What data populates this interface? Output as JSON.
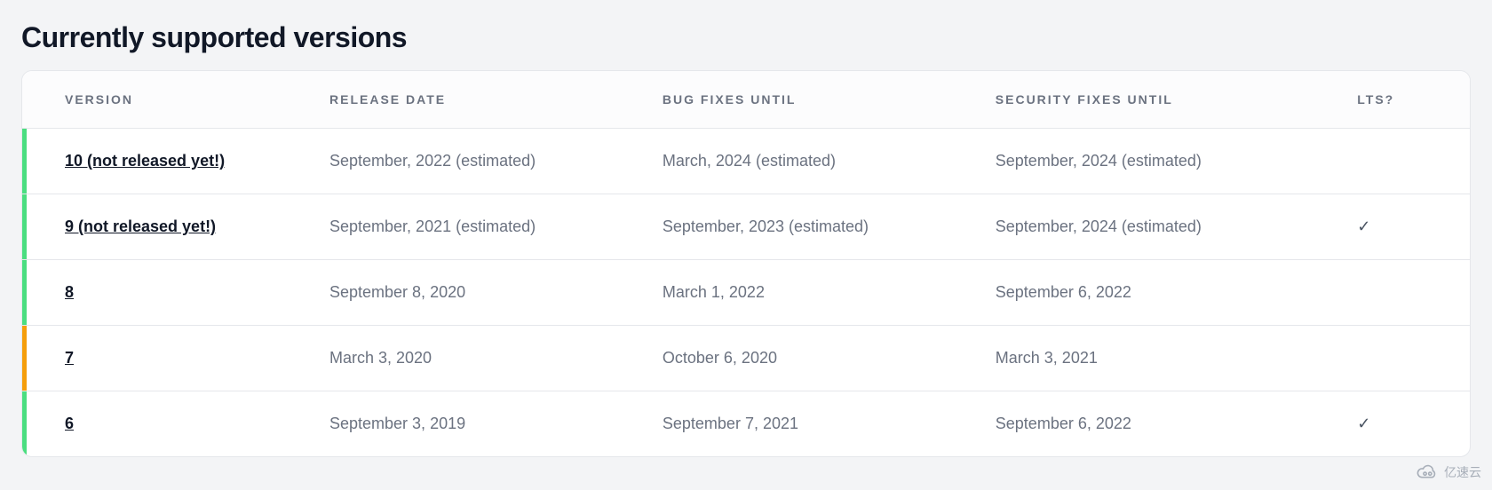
{
  "title": "Currently supported versions",
  "columns": {
    "version": "Version",
    "release_date": "Release Date",
    "bug_fixes_until": "Bug Fixes Until",
    "security_fixes_until": "Security Fixes Until",
    "lts": "LTS?"
  },
  "status_colors": {
    "future": "#4ade80",
    "active": "#4ade80",
    "security": "#f59e0b",
    "lts_active": "#4ade80"
  },
  "lts_check_glyph": "✓",
  "rows": [
    {
      "version": "10 (not released yet!)",
      "release_date": "September, 2022 (estimated)",
      "bug_fixes_until": "March, 2024 (estimated)",
      "security_fixes_until": "September, 2024 (estimated)",
      "lts": false,
      "stripe": "green"
    },
    {
      "version": "9 (not released yet!)",
      "release_date": "September, 2021 (estimated)",
      "bug_fixes_until": "September, 2023 (estimated)",
      "security_fixes_until": "September, 2024 (estimated)",
      "lts": true,
      "stripe": "green"
    },
    {
      "version": "8",
      "release_date": "September 8, 2020",
      "bug_fixes_until": "March 1, 2022",
      "security_fixes_until": "September 6, 2022",
      "lts": false,
      "stripe": "green"
    },
    {
      "version": "7",
      "release_date": "March 3, 2020",
      "bug_fixes_until": "October 6, 2020",
      "security_fixes_until": "March 3, 2021",
      "lts": false,
      "stripe": "orange"
    },
    {
      "version": "6",
      "release_date": "September 3, 2019",
      "bug_fixes_until": "September 7, 2021",
      "security_fixes_until": "September 6, 2022",
      "lts": true,
      "stripe": "green"
    }
  ],
  "watermark": {
    "text": "亿速云"
  }
}
